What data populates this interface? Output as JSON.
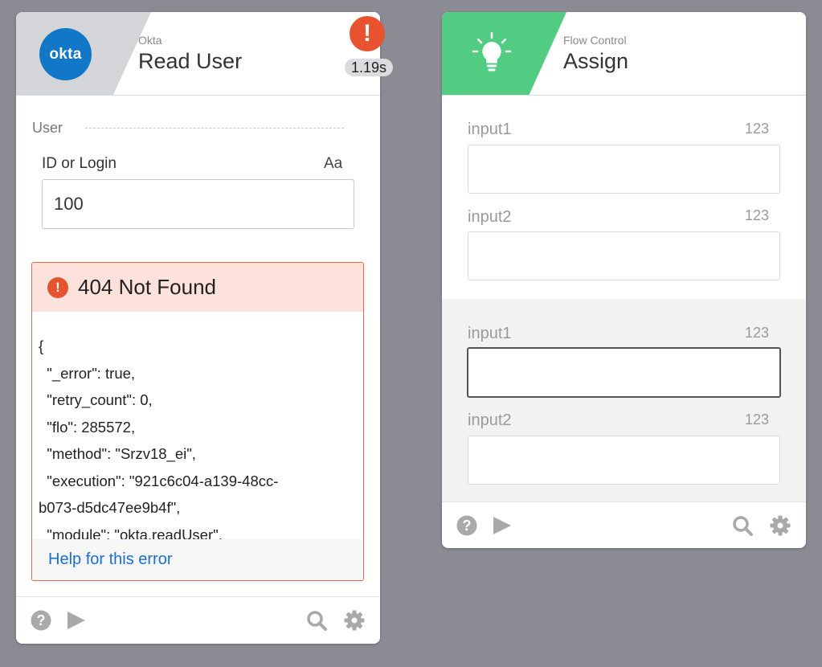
{
  "okta_card": {
    "category": "Okta",
    "title": "Read User",
    "logo_text": "okta",
    "error_badge": "!",
    "elapsed": "1.19s",
    "section_label": "User",
    "field": {
      "label": "ID or Login",
      "type_badge": "Aa",
      "value": "100"
    },
    "error": {
      "title": "404 Not Found",
      "body": "{\n  \"_error\": true,\n  \"retry_count\": 0,\n  \"flo\": 285572,\n  \"method\": \"Srzv18_ei\",\n  \"execution\": \"921c6c04-a139-48cc-\nb073-d5dc47ee9b4f\",\n  \"module\": \"okta.readUser\",",
      "help_link": "Help for this error"
    }
  },
  "assign_card": {
    "category": "Flow Control",
    "title": "Assign",
    "inputs_top": [
      {
        "label": "input1",
        "type_badge": "123",
        "value": ""
      },
      {
        "label": "input2",
        "type_badge": "123",
        "value": ""
      }
    ],
    "inputs_bottom": [
      {
        "label": "input1",
        "type_badge": "123",
        "value": ""
      },
      {
        "label": "input2",
        "type_badge": "123",
        "value": ""
      }
    ]
  },
  "icons": [
    "okta-logo",
    "lightbulb-icon",
    "help-icon",
    "play-icon",
    "search-icon",
    "gear-icon",
    "error-icon"
  ],
  "colors": {
    "background": "#8b8b93",
    "okta_blue": "#1377c7",
    "flow_control_green": "#52cc83",
    "error_red": "#e8522f",
    "error_bg": "#fde2db",
    "link_blue": "#1a6fce"
  }
}
